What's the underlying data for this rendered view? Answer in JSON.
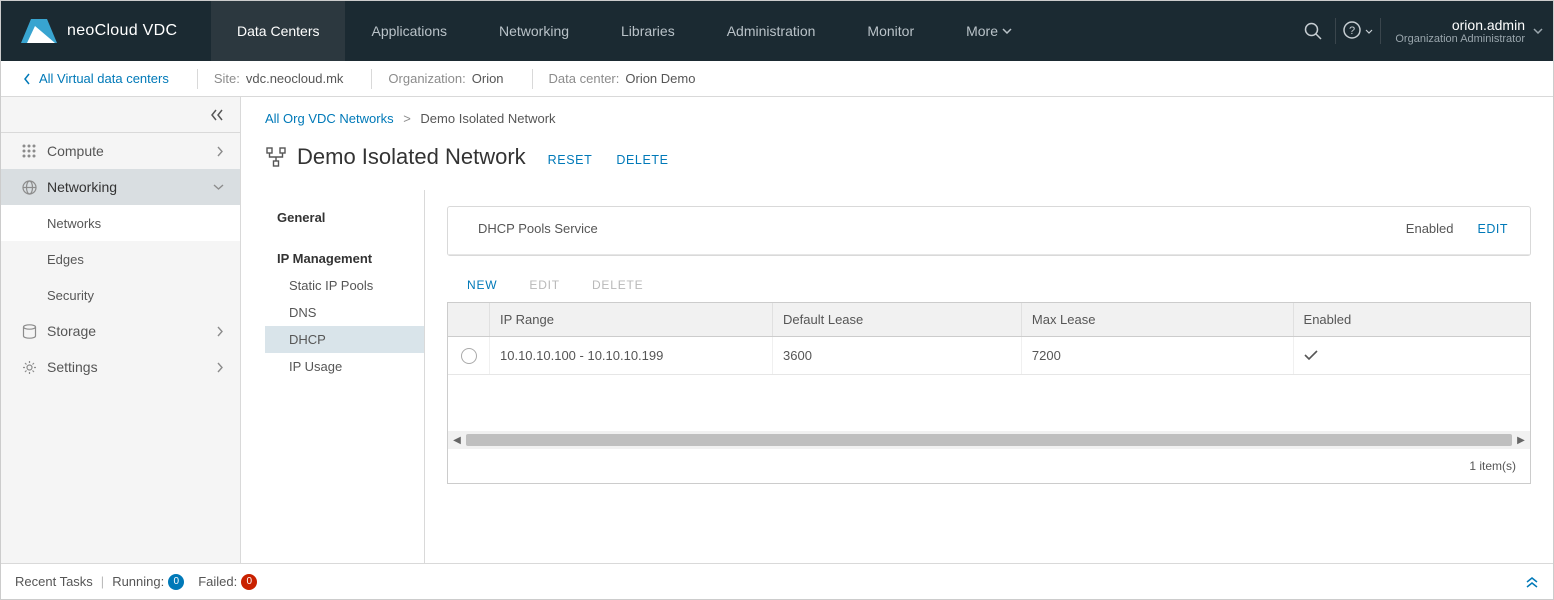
{
  "brand": {
    "name": "neoCloud VDC"
  },
  "nav": {
    "tabs": [
      "Data Centers",
      "Applications",
      "Networking",
      "Libraries",
      "Administration",
      "Monitor",
      "More"
    ],
    "active_index": 0
  },
  "user": {
    "name": "orion.admin",
    "role": "Organization Administrator"
  },
  "context": {
    "back_label": "All Virtual data centers",
    "site_label": "Site:",
    "site_value": "vdc.neocloud.mk",
    "org_label": "Organization:",
    "org_value": "Orion",
    "dc_label": "Data center:",
    "dc_value": "Orion Demo"
  },
  "sidebar": {
    "items": [
      {
        "label": "Compute",
        "icon": "grid",
        "expandable": true,
        "expanded": false
      },
      {
        "label": "Networking",
        "icon": "globe",
        "expandable": true,
        "expanded": true,
        "children": [
          {
            "label": "Networks",
            "active": true
          },
          {
            "label": "Edges"
          },
          {
            "label": "Security"
          }
        ]
      },
      {
        "label": "Storage",
        "icon": "storage",
        "expandable": true,
        "expanded": false
      },
      {
        "label": "Settings",
        "icon": "gear",
        "expandable": true,
        "expanded": false
      }
    ]
  },
  "breadcrumb": {
    "parent": "All Org VDC Networks",
    "current": "Demo Isolated Network"
  },
  "page": {
    "title": "Demo Isolated Network",
    "reset_label": "RESET",
    "delete_label": "DELETE"
  },
  "detail_nav": {
    "general_label": "General",
    "ip_mgmt_label": "IP Management",
    "sub": [
      "Static IP Pools",
      "DNS",
      "DHCP",
      "IP Usage"
    ],
    "selected_index": 2
  },
  "dhcp_panel": {
    "title": "DHCP Pools Service",
    "status": "Enabled",
    "edit_label": "EDIT"
  },
  "tbl": {
    "actions": {
      "new": "NEW",
      "edit": "EDIT",
      "delete": "DELETE"
    },
    "headers": {
      "range": "IP Range",
      "default_lease": "Default Lease",
      "max_lease": "Max Lease",
      "enabled": "Enabled"
    },
    "rows": [
      {
        "range": "10.10.10.100 - 10.10.10.199",
        "default_lease": "3600",
        "max_lease": "7200",
        "enabled": true
      }
    ],
    "footer": "1 item(s)"
  },
  "status": {
    "recent_tasks": "Recent Tasks",
    "running_label": "Running:",
    "running_count": "0",
    "failed_label": "Failed:",
    "failed_count": "0"
  }
}
